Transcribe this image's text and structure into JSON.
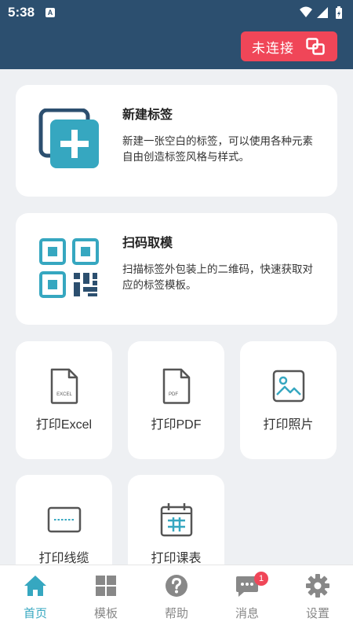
{
  "status_bar": {
    "time": "5:38",
    "notification_glyph": "A"
  },
  "header": {
    "connect_label": "未连接"
  },
  "cards": [
    {
      "title": "新建标签",
      "description": "新建一张空白的标签，可以使用各种元素自由创造标签风格与样式。"
    },
    {
      "title": "扫码取模",
      "description": "扫描标签外包装上的二维码，快速获取对应的标签模板。"
    }
  ],
  "tiles": [
    {
      "label": "打印Excel",
      "icon": "excel-file-icon",
      "icon_text": "EXCEL"
    },
    {
      "label": "打印PDF",
      "icon": "pdf-file-icon",
      "icon_text": "PDF"
    },
    {
      "label": "打印照片",
      "icon": "photo-icon"
    },
    {
      "label": "打印线缆",
      "icon": "cable-label-icon"
    },
    {
      "label": "打印课表",
      "icon": "timetable-icon"
    }
  ],
  "nav": [
    {
      "label": "首页",
      "icon": "home-icon",
      "active": true
    },
    {
      "label": "模板",
      "icon": "grid-icon",
      "active": false
    },
    {
      "label": "帮助",
      "icon": "help-icon",
      "active": false
    },
    {
      "label": "消息",
      "icon": "message-icon",
      "active": false,
      "badge": "1"
    },
    {
      "label": "设置",
      "icon": "gear-icon",
      "active": false
    }
  ],
  "colors": {
    "header": "#2c4f6f",
    "accent": "#36a7c0",
    "alert": "#f04658",
    "background": "#eef0f3"
  }
}
